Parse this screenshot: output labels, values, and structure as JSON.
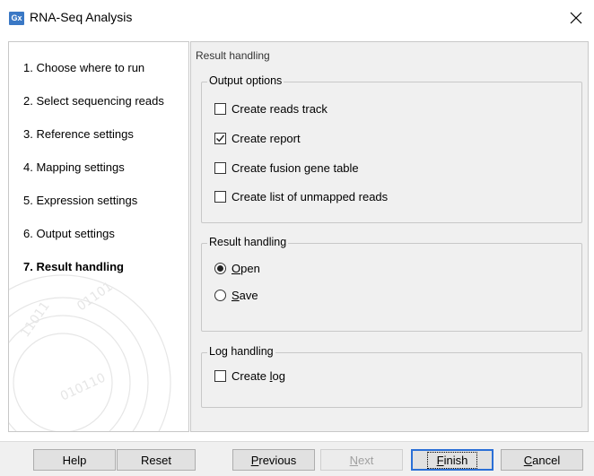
{
  "window": {
    "icon_text": "Gx",
    "title": "RNA-Seq Analysis",
    "close_glyph": "✕"
  },
  "steps": [
    {
      "number": "1.",
      "label": "Choose where to run"
    },
    {
      "number": "2.",
      "label": "Select sequencing reads"
    },
    {
      "number": "3.",
      "label": "Reference settings"
    },
    {
      "number": "4.",
      "label": "Mapping settings"
    },
    {
      "number": "5.",
      "label": "Expression settings"
    },
    {
      "number": "6.",
      "label": "Output settings"
    },
    {
      "number": "7.",
      "label": "Result handling",
      "active": true
    }
  ],
  "panel": {
    "heading": "Result handling",
    "output_options": {
      "title": "Output options",
      "items": [
        {
          "label": "Create reads track",
          "checked": false
        },
        {
          "label": "Create report",
          "checked": true
        },
        {
          "label": "Create fusion gene table",
          "checked": false
        },
        {
          "label": "Create list of unmapped reads",
          "checked": false
        }
      ]
    },
    "result_handling": {
      "title": "Result handling",
      "open": {
        "label": "Open",
        "mnemonic": "O",
        "rest": "pen",
        "selected": true
      },
      "save": {
        "label": "Save",
        "mnemonic": "S",
        "rest": "ave",
        "selected": false
      }
    },
    "log_handling": {
      "title": "Log handling",
      "create_log": {
        "label": "Create log",
        "before": "Create ",
        "mnemonic": "l",
        "after": "og",
        "checked": false
      }
    }
  },
  "buttons": {
    "help": "Help",
    "reset": "Reset",
    "previous": {
      "label": "Previous",
      "mnemonic": "P",
      "rest": "revious"
    },
    "next": {
      "label": "Next",
      "mnemonic": "N",
      "rest": "ext"
    },
    "finish": {
      "label": "Finish",
      "mnemonic": "F",
      "rest": "inish"
    },
    "cancel": {
      "label": "Cancel",
      "mnemonic": "C",
      "rest": "ancel"
    }
  }
}
